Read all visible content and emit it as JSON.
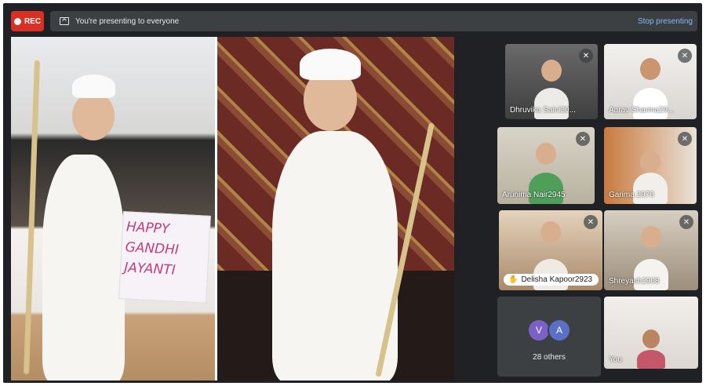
{
  "recording": {
    "label": "REC",
    "color": "#d93025"
  },
  "presenting_bar": {
    "message": "You're presenting to everyone",
    "stop_label": "Stop presenting",
    "icon": "present-screen-icon"
  },
  "presentation": {
    "sign_lines": [
      "HAPPY",
      "GANDHI",
      "JAYANTI"
    ]
  },
  "participants": [
    {
      "name": "Dhruvika Saini30...",
      "muted": true
    },
    {
      "name": "Aarav Sharma29...",
      "muted": true
    },
    {
      "name": "Arunima Nair2945",
      "muted": true
    },
    {
      "name": "Garima 2970",
      "muted": true
    },
    {
      "name": "Delisha Kapoor2923",
      "muted": true,
      "hand_raised": true
    },
    {
      "name": "Shreyash2908",
      "muted": true
    },
    {
      "name": "You",
      "muted": false
    }
  ],
  "others": {
    "avatars": [
      "V",
      "A"
    ],
    "label": "28 others"
  },
  "colors": {
    "accent": "#8ab4f8",
    "background": "#202124",
    "tile": "#3c4043"
  }
}
